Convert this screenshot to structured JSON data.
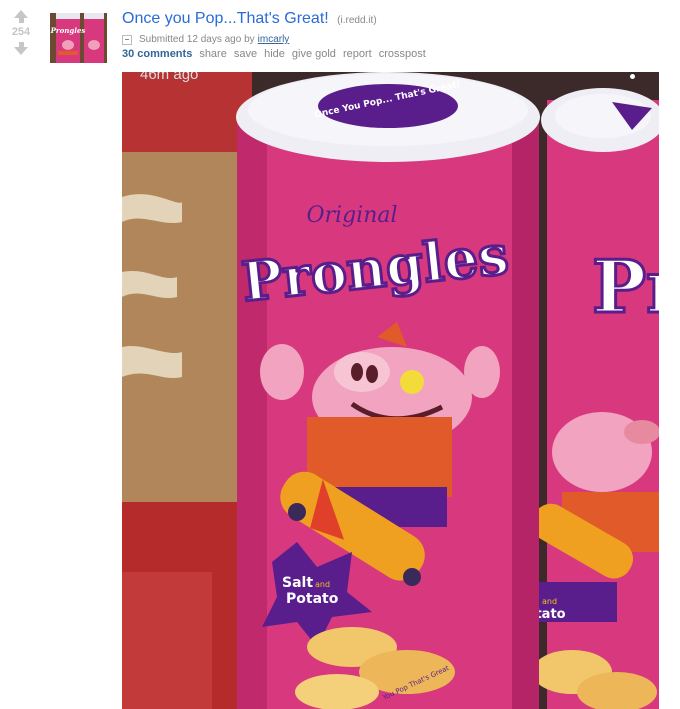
{
  "vote": {
    "score": "254"
  },
  "post": {
    "title": "Once you Pop...That's Great!",
    "domain": "i.redd.it",
    "submitted_text": "Submitted 12 days ago by",
    "author": "imcarly"
  },
  "buttons": {
    "comments": "30 comments",
    "share": "share",
    "save": "save",
    "hide": "hide",
    "give_gold": "give gold",
    "report": "report",
    "crosspost": "crosspost"
  },
  "image": {
    "timestamp": "46m ago",
    "can_lid_text": "Once You Pop... That's Great!",
    "brand_original": "Original",
    "brand_name": "Prongles",
    "flavor_line1": "Salt",
    "flavor_and": "and",
    "flavor_line2": "Potato",
    "slogan": "You Pop That's Great"
  },
  "thumbnail": {
    "brand_name": "Prongles"
  },
  "colors": {
    "title_link": "#2a6bd8",
    "can_pink": "#d8387e",
    "lid_purple": "#5a1e8c",
    "box_cardboard": "#b0865a"
  }
}
